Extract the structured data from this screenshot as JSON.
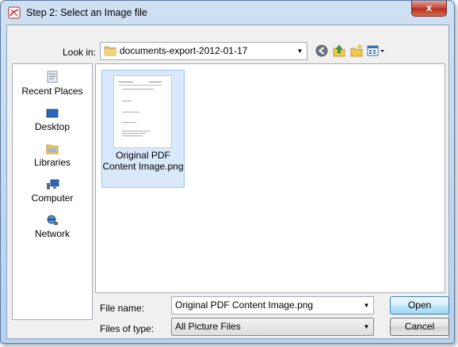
{
  "window": {
    "title": "Step 2: Select an Image file",
    "close_label": "x"
  },
  "lookin": {
    "label": "Look in:",
    "value": "documents-export-2012-01-17"
  },
  "toolbar": {
    "back_icon": "back-icon",
    "up_icon": "up-folder-icon",
    "new_folder_icon": "new-folder-icon",
    "views_icon": "views-menu-icon"
  },
  "sidebar": {
    "items": [
      {
        "label": "Recent Places",
        "icon": "recent-places-icon"
      },
      {
        "label": "Desktop",
        "icon": "desktop-icon"
      },
      {
        "label": "Libraries",
        "icon": "libraries-icon"
      },
      {
        "label": "Computer",
        "icon": "computer-icon"
      },
      {
        "label": "Network",
        "icon": "network-icon"
      }
    ]
  },
  "files": [
    {
      "name": "Original PDF Content Image.png",
      "selected": true
    }
  ],
  "filename": {
    "label": "File name:",
    "value": "Original PDF Content Image.png"
  },
  "filetype": {
    "label": "Files of type:",
    "value": "All Picture Files"
  },
  "buttons": {
    "open": "Open",
    "cancel": "Cancel"
  },
  "colors": {
    "selection_bg": "#d9e9fb",
    "selection_border": "#99c4f1",
    "accent": "#3c7fb1"
  }
}
